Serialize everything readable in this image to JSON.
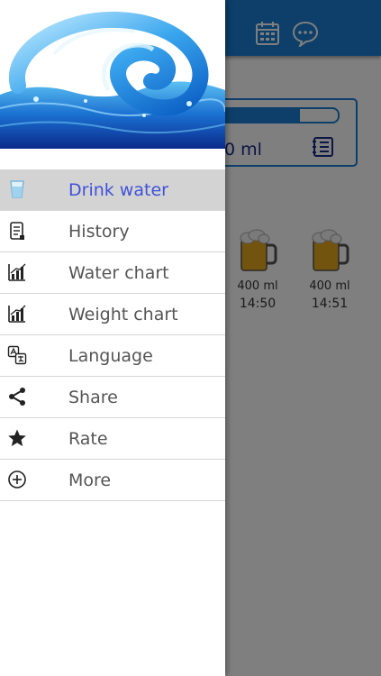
{
  "header": {
    "calendar_icon": "calendar-icon",
    "chat_icon": "chat-icon"
  },
  "progress": {
    "fill_fraction": 0.69,
    "amount_text": "0 ml",
    "notebook_icon": "notebook-icon"
  },
  "drinks": [
    {
      "icon": "beer-mug-icon",
      "amount": "400 ml",
      "time": "14:50"
    },
    {
      "icon": "beer-mug-icon",
      "amount": "400 ml",
      "time": "14:51"
    }
  ],
  "drawer": {
    "items": [
      {
        "label": "Drink water",
        "icon": "glass-icon",
        "active": true
      },
      {
        "label": "History",
        "icon": "scroll-icon",
        "active": false
      },
      {
        "label": "Water chart",
        "icon": "bar-chart-icon",
        "active": false
      },
      {
        "label": "Weight chart",
        "icon": "bar-chart-icon",
        "active": false
      },
      {
        "label": "Language",
        "icon": "translate-icon",
        "active": false
      },
      {
        "label": "Share",
        "icon": "share-icon",
        "active": false
      },
      {
        "label": "Rate",
        "icon": "star-icon",
        "active": false
      },
      {
        "label": "More",
        "icon": "plus-circle-icon",
        "active": false
      }
    ]
  },
  "colors": {
    "header": "#1a7ed4",
    "active_label": "#3f51d8",
    "active_bg": "#d3d3d3"
  }
}
